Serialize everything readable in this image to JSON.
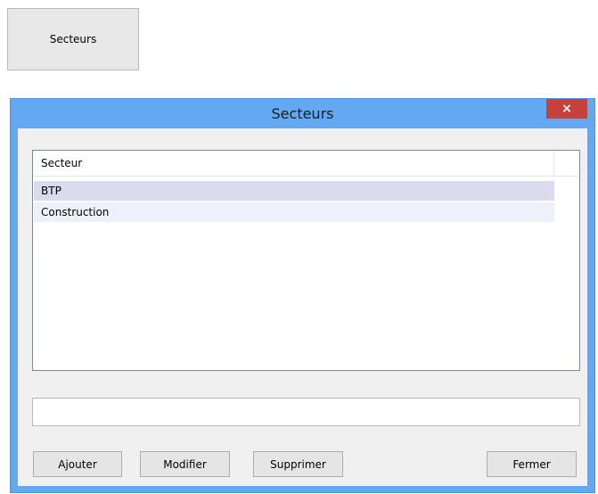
{
  "launcher": {
    "label": "Secteurs"
  },
  "window": {
    "title": "Secteurs",
    "close_label": "×"
  },
  "listview": {
    "column_header": "Secteur",
    "rows": [
      {
        "label": "BTP"
      },
      {
        "label": "Construction"
      }
    ]
  },
  "input": {
    "value": "",
    "placeholder": ""
  },
  "buttons": {
    "add": "Ajouter",
    "edit": "Modifier",
    "delete": "Supprimer",
    "close": "Fermer"
  }
}
